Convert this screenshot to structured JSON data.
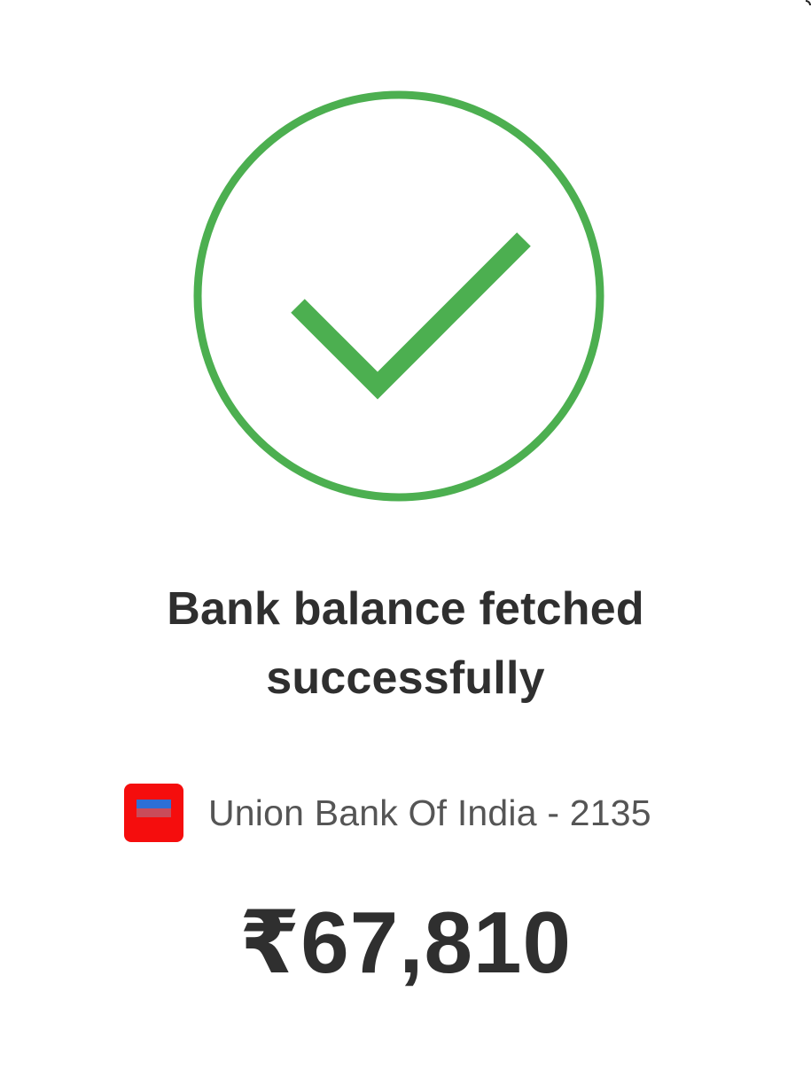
{
  "colors": {
    "success_green": "#4caf50",
    "text_dark": "#2f2f2f",
    "text_muted": "#555555",
    "bank_logo_red": "#f50d0d",
    "bank_logo_blue": "#2c6fd6"
  },
  "status": {
    "icon": "check-circle-icon",
    "title": "Bank balance fetched successfully"
  },
  "account": {
    "logo_icon": "union-bank-logo",
    "label": "Union Bank Of India - 2135"
  },
  "balance": {
    "amount": "₹67,810"
  }
}
